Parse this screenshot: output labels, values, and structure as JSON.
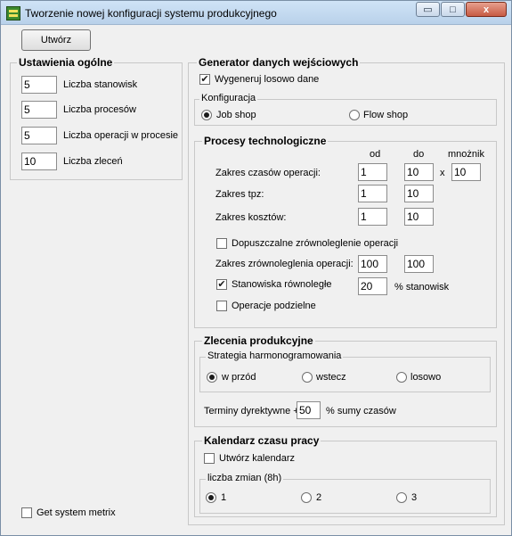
{
  "window": {
    "title": "Tworzenie nowej konfiguracji systemu produkcyjnego",
    "min_glyph": "▭",
    "max_glyph": "□",
    "close_glyph": "x"
  },
  "toolbar": {
    "create_label": "Utwórz"
  },
  "general": {
    "title": "Ustawienia ogólne",
    "stations": {
      "value": "5",
      "label": "Liczba stanowisk"
    },
    "processes": {
      "value": "5",
      "label": "Liczba procesów"
    },
    "operations": {
      "value": "5",
      "label": "Liczba operacji w procesie"
    },
    "orders": {
      "value": "10",
      "label": "Liczba zleceń"
    }
  },
  "system_metrix": {
    "label": "Get system metrix",
    "checked": false
  },
  "generator": {
    "title": "Generator danych wejściowych",
    "random": {
      "label": "Wygeneruj losowo dane",
      "checked": true,
      "mark": "✔"
    },
    "config": {
      "title": "Konfiguracja",
      "job_shop": "Job shop",
      "flow_shop": "Flow shop",
      "selected": "Job shop"
    }
  },
  "processes": {
    "title": "Procesy technologiczne",
    "col_from": "od",
    "col_to": "do",
    "col_mult": "mnożnik",
    "times": {
      "label": "Zakres czasów operacji:",
      "from": "1",
      "to": "10",
      "x": "x",
      "mult": "10"
    },
    "tpz": {
      "label": "Zakres tpz:",
      "from": "1",
      "to": "10"
    },
    "costs": {
      "label": "Zakres kosztów:",
      "from": "1",
      "to": "10"
    },
    "parallel_allowed": {
      "label": "Dopuszczalne zrównoleglenie operacji",
      "checked": false
    },
    "parallel_range": {
      "label": "Zakres zrównoleglenia operacji:",
      "from": "100",
      "to": "100"
    },
    "parallel_stations": {
      "label": "Stanowiska równoległe",
      "checked": true,
      "mark": "✔",
      "value": "20",
      "suffix": "% stanowisk"
    },
    "divisible_ops": {
      "label": "Operacje podzielne",
      "checked": false
    }
  },
  "orders": {
    "title": "Zlecenia produkcyjne",
    "strategy": {
      "title": "Strategia harmonogramowania",
      "forward": "w przód",
      "backward": "wstecz",
      "random": "losowo",
      "selected": "w przód"
    },
    "deadline": {
      "label": "Terminy dyrektywne +",
      "value": "50",
      "suffix": "% sumy czasów"
    }
  },
  "calendar": {
    "title": "Kalendarz czasu pracy",
    "create": {
      "label": "Utwórz kalendarz",
      "checked": false
    },
    "shifts": {
      "title": "liczba zmian (8h)",
      "one": "1",
      "two": "2",
      "three": "3",
      "selected": "1"
    }
  }
}
